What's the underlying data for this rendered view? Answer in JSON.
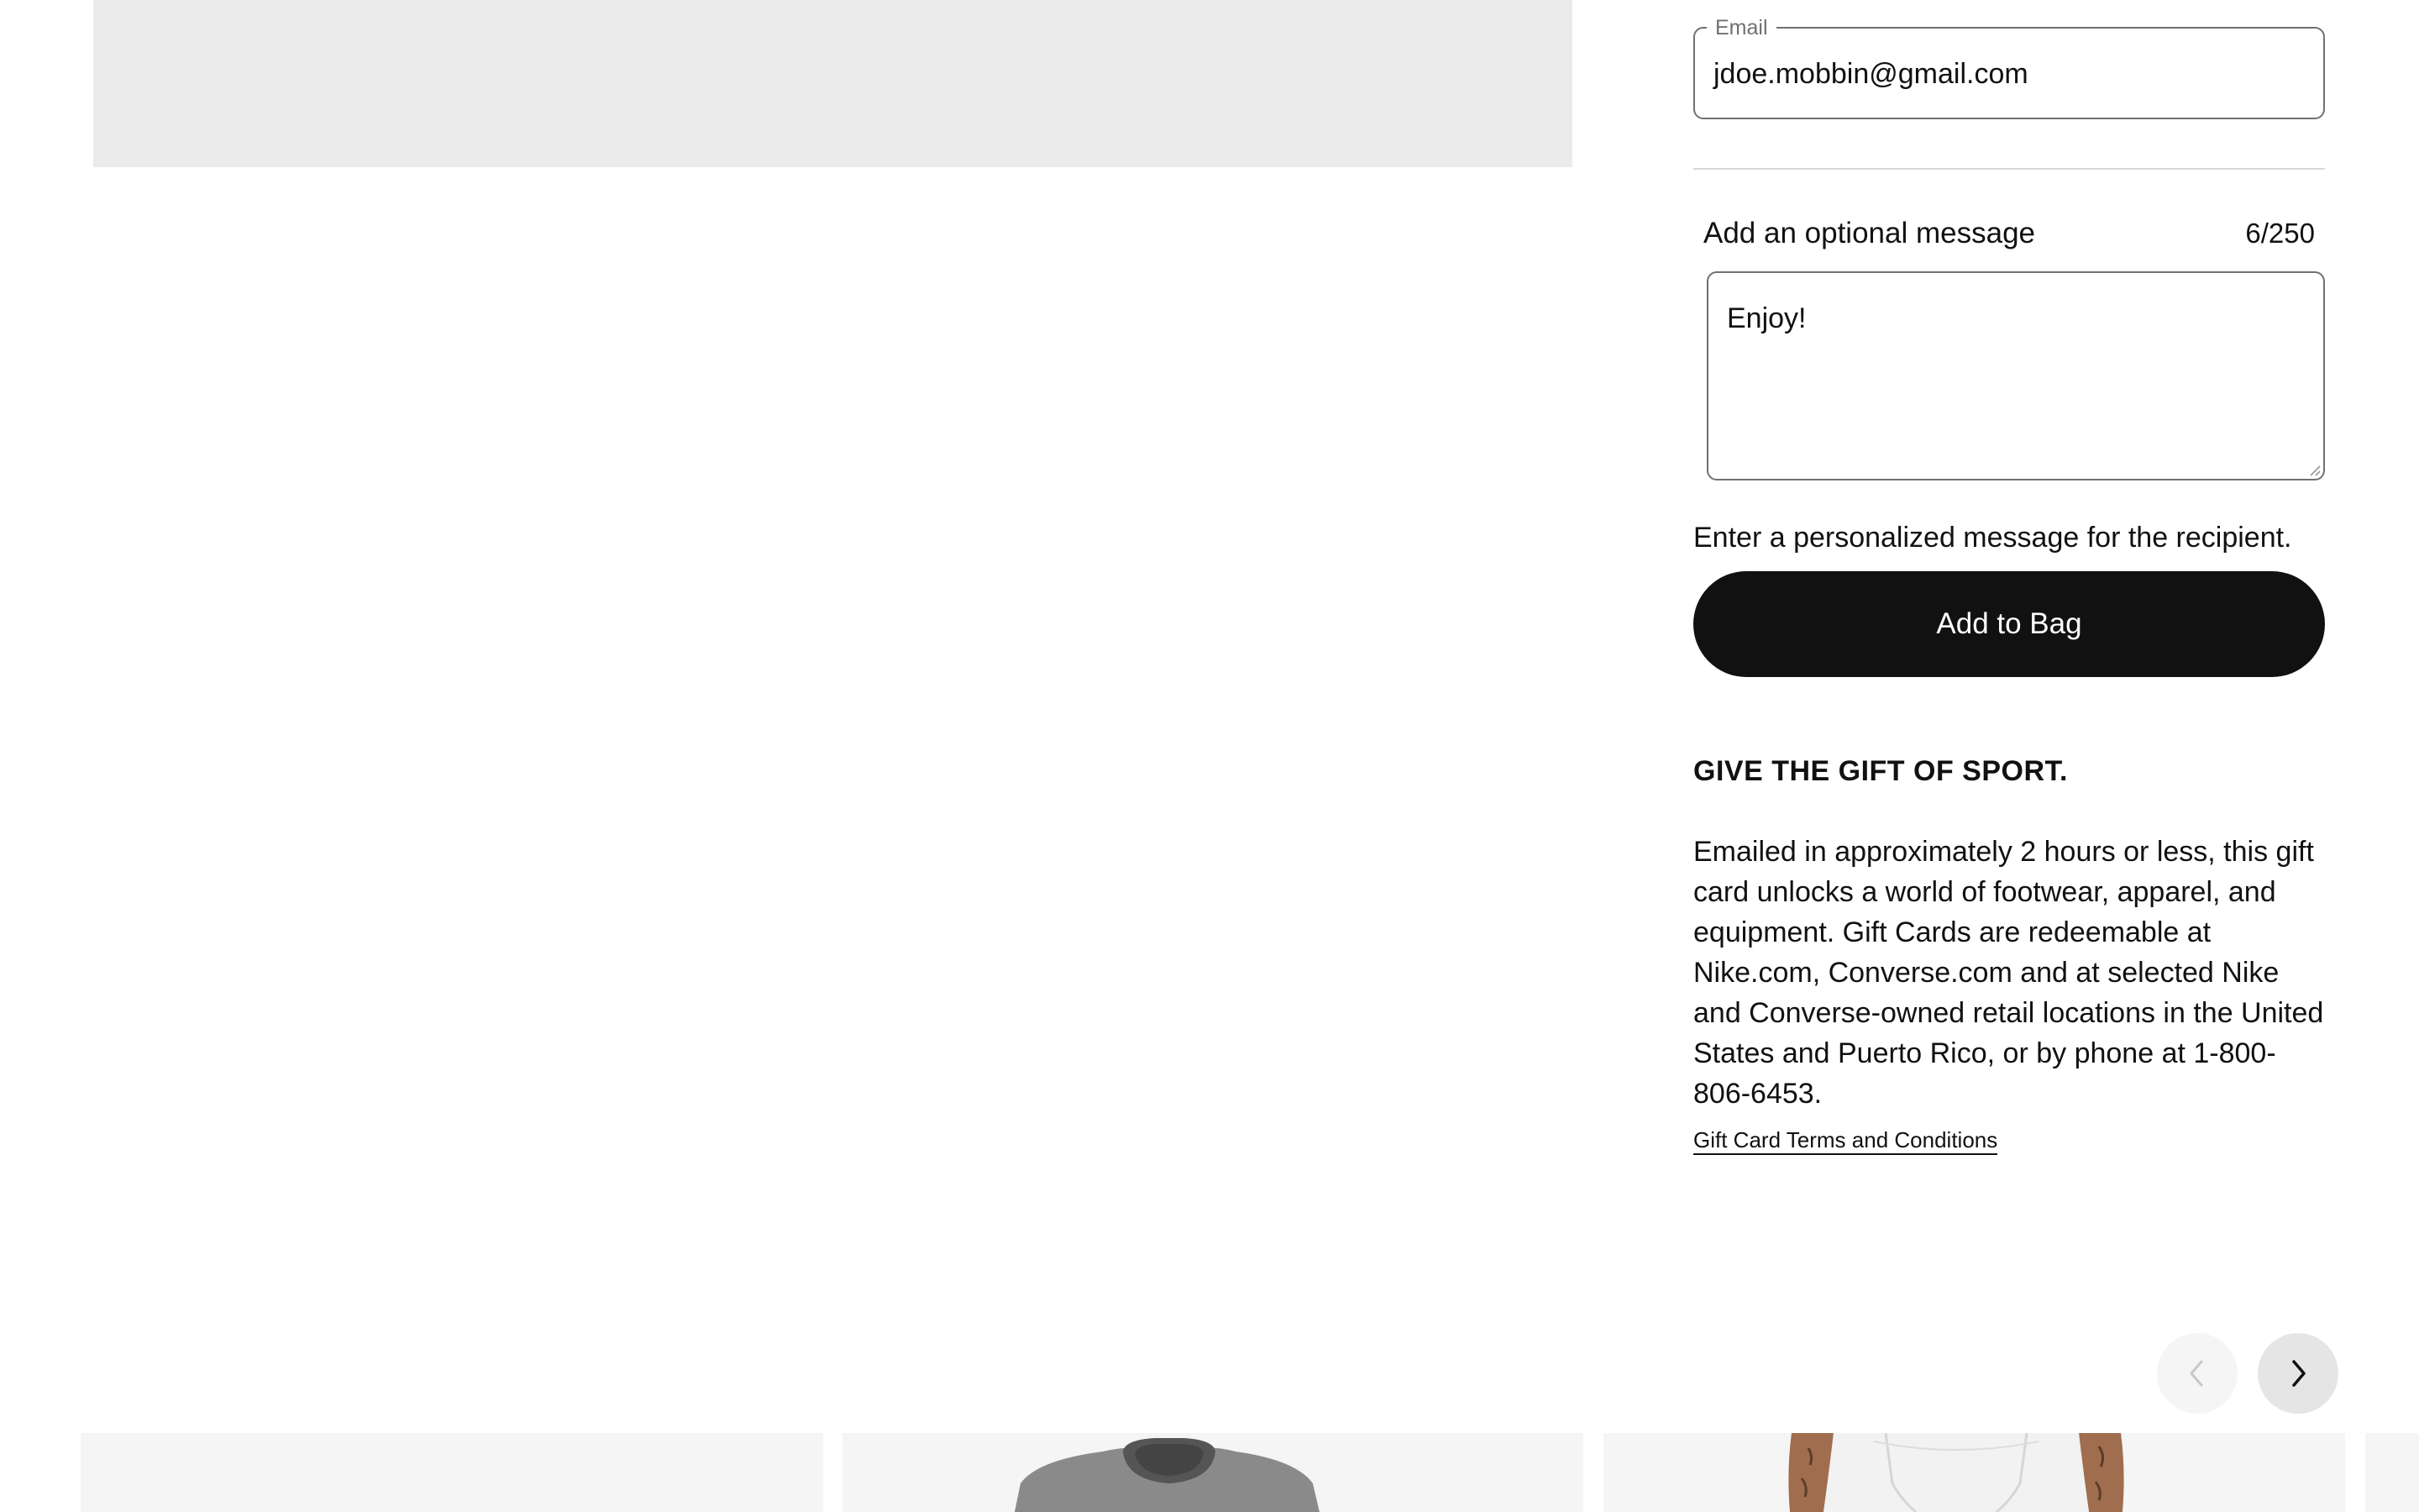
{
  "email": {
    "label": "Email",
    "value": "jdoe.mobbin@gmail.com"
  },
  "message": {
    "title": "Add an optional message",
    "counter": "6/250",
    "value": "Enjoy!",
    "helper": "Enter a personalized message for the recipient."
  },
  "actions": {
    "add_to_bag": "Add to Bag"
  },
  "promo": {
    "heading": "GIVE THE GIFT OF SPORT.",
    "body": "Emailed in approximately 2 hours or less, this gift card unlocks a world of footwear, apparel, and equipment. Gift Cards are redeemable at Nike.com, Converse.com and at selected Nike and Converse-owned retail locations in the United States and Puerto Rico, or by phone at 1-800-806-6453.",
    "terms_link": "Gift Card Terms and Conditions"
  },
  "carousel": {
    "prev_icon": "chevron-left-icon",
    "next_icon": "chevron-right-icon"
  },
  "colors": {
    "primary_button": "#111111",
    "card_background": "#f5f5f5",
    "placeholder": "#ebebeb"
  }
}
